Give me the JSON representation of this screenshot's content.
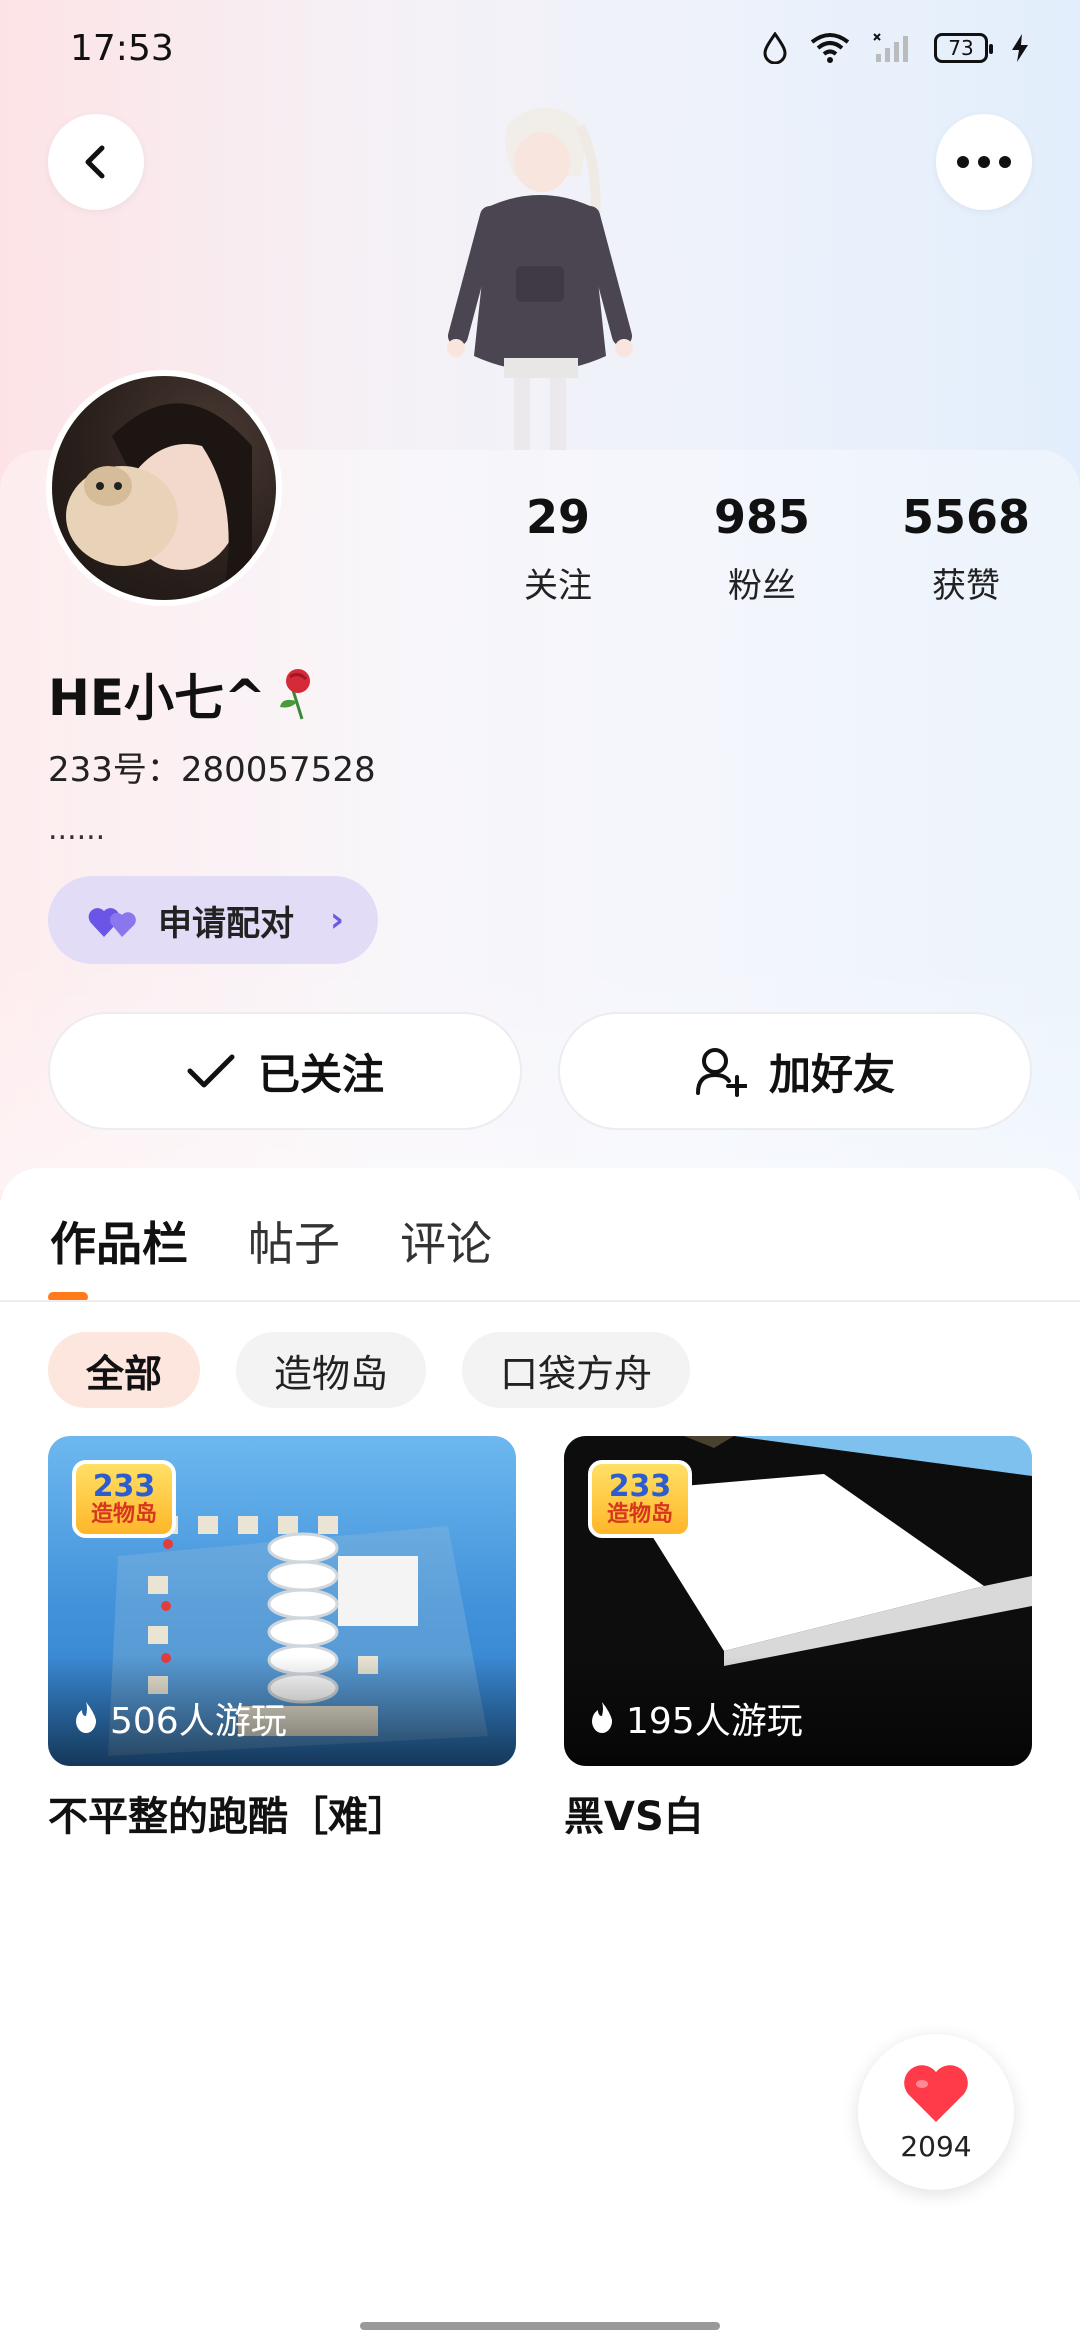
{
  "status_bar": {
    "time": "17:53",
    "battery": "73"
  },
  "profile": {
    "nickname": "HE小七^",
    "uid_label": "233号：280057528",
    "bio": "......",
    "pair_button": "申请配对",
    "follow_button": "已关注",
    "add_friend_button": "加好友"
  },
  "stats": [
    {
      "value": "29",
      "label": "关注"
    },
    {
      "value": "985",
      "label": "粉丝"
    },
    {
      "value": "5568",
      "label": "获赞"
    }
  ],
  "tabs": [
    "作品栏",
    "帖子",
    "评论"
  ],
  "filters": [
    "全部",
    "造物岛",
    "口袋方舟"
  ],
  "games": [
    {
      "title": "不平整的跑酷［难］",
      "plays": "506人游玩",
      "badge_top": "233",
      "badge_bottom": "造物岛"
    },
    {
      "title": "黑VS白",
      "plays": "195人游玩",
      "badge_top": "233",
      "badge_bottom": "造物岛"
    }
  ],
  "like_count": "2094",
  "colors": {
    "accent": "#ff7a1a",
    "pair_bg": "#e3dcf7",
    "like": "#ff3b4a"
  }
}
